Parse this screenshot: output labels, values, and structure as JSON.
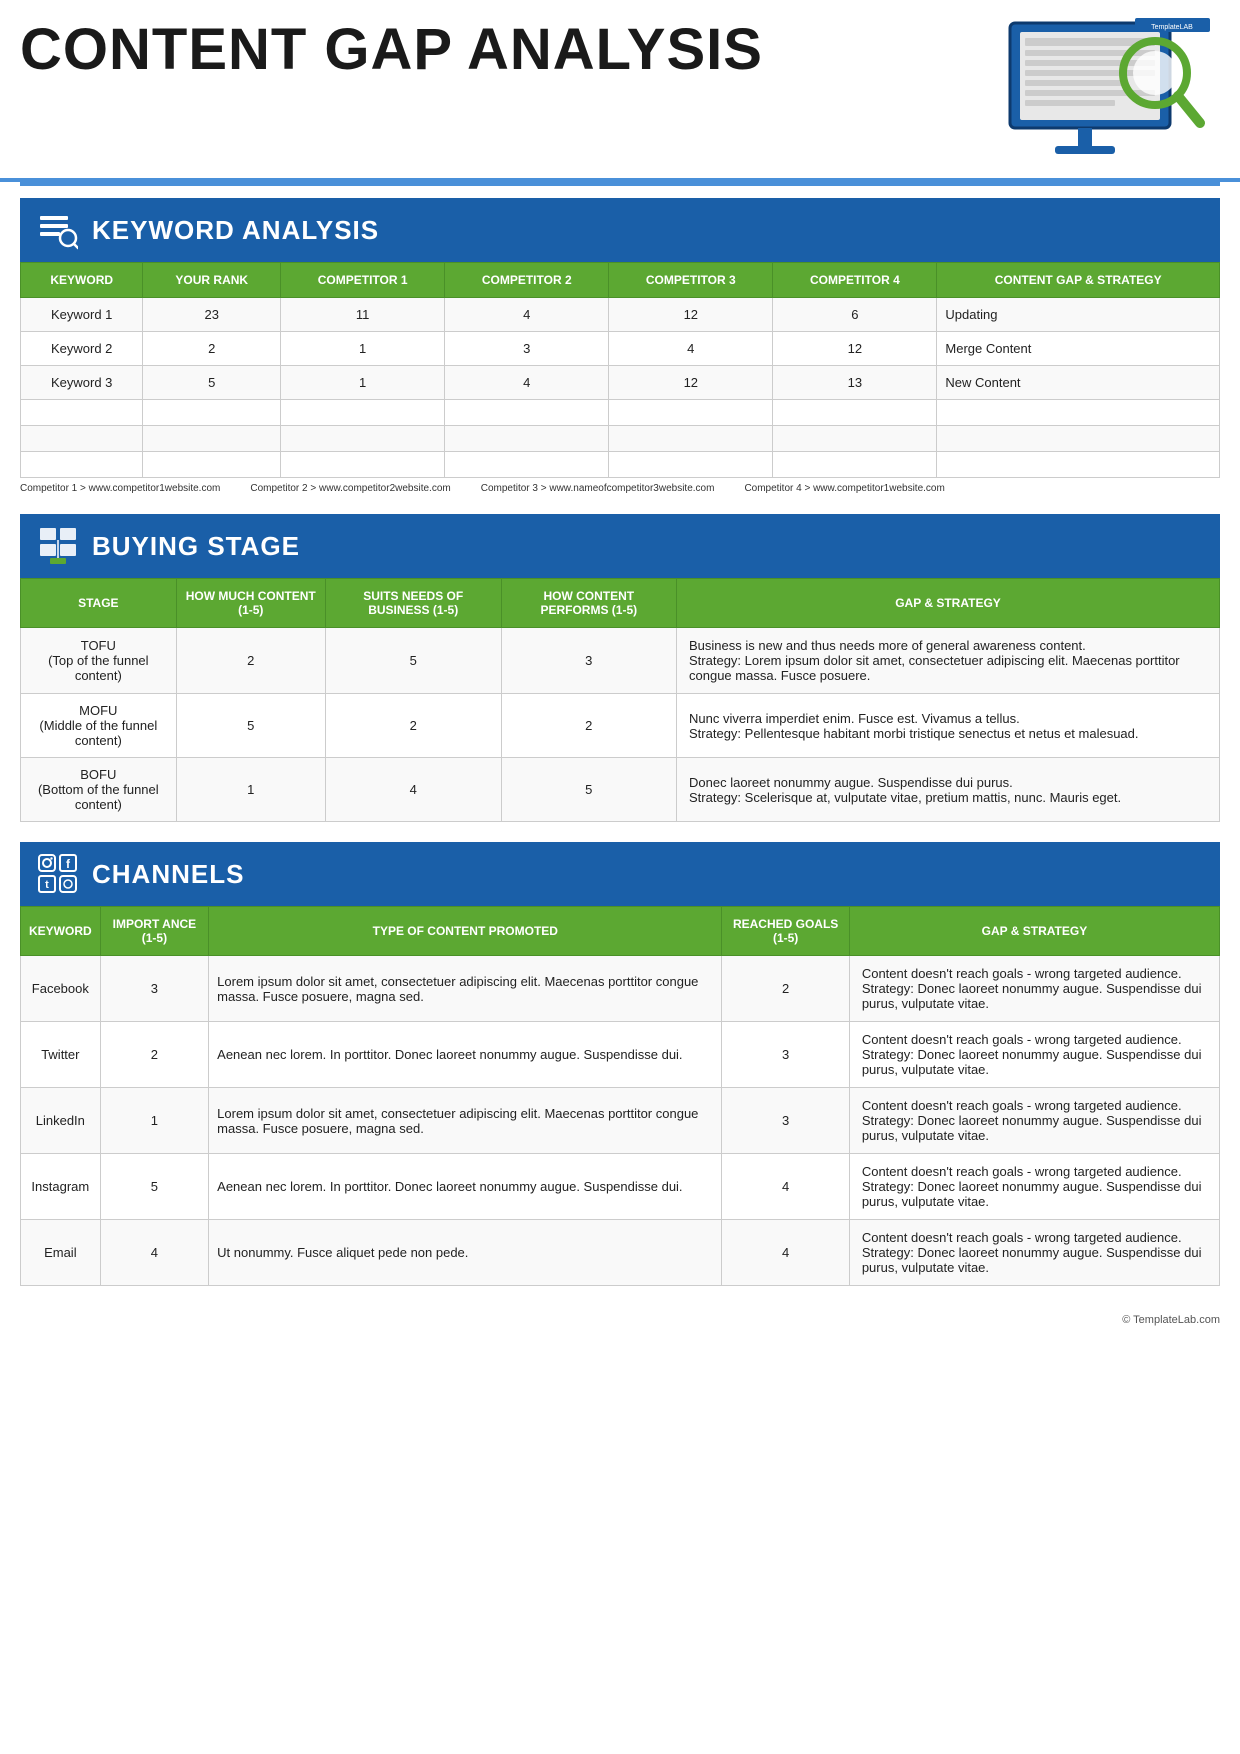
{
  "header": {
    "title": "CONTENT GAP ANALYSIS",
    "watermark": "© TemplateLab.com"
  },
  "keyword_section": {
    "section_title": "KEYWORD ANALYSIS",
    "table": {
      "headers": [
        "KEYWORD",
        "Your Rank",
        "Competitor 1",
        "Competitor 2",
        "Competitor 3",
        "Competitor 4",
        "Content Gap & Strategy"
      ],
      "rows": [
        [
          "Keyword 1",
          "23",
          "11",
          "4",
          "12",
          "6",
          "Updating"
        ],
        [
          "Keyword 2",
          "2",
          "1",
          "3",
          "4",
          "12",
          "Merge Content"
        ],
        [
          "Keyword 3",
          "5",
          "1",
          "4",
          "12",
          "13",
          "New Content"
        ],
        [
          "",
          "",
          "",
          "",
          "",
          "",
          ""
        ],
        [
          "",
          "",
          "",
          "",
          "",
          "",
          ""
        ],
        [
          "",
          "",
          "",
          "",
          "",
          "",
          ""
        ]
      ]
    },
    "competitor_notes": [
      "Competitor 1 > www.competitor1website.com",
      "Competitor 2 > www.competitor2website.com",
      "Competitor 3 > www.nameofcompetitor3website.com",
      "Competitor 4 > www.competitor1website.com"
    ]
  },
  "buying_stage_section": {
    "section_title": "BUYING STAGE",
    "table": {
      "headers": [
        "STAGE",
        "How Much Content (1-5)",
        "Suits Needs of Business (1-5)",
        "How Content Performs (1-5)",
        "Gap & Strategy"
      ],
      "rows": [
        {
          "stage": "TOFU\n(Top of the funnel content)",
          "col2": "2",
          "col3": "5",
          "col4": "3",
          "gap": "Business is new and thus needs more of general awareness content.\nStrategy: Lorem ipsum dolor sit amet, consectetuer adipiscing elit. Maecenas porttitor congue massa. Fusce posuere."
        },
        {
          "stage": "MOFU\n(Middle of the funnel content)",
          "col2": "5",
          "col3": "2",
          "col4": "2",
          "gap": "Nunc viverra imperdiet enim. Fusce est. Vivamus a tellus.\nStrategy: Pellentesque habitant morbi tristique senectus et netus et malesuad."
        },
        {
          "stage": "BOFU\n(Bottom of the funnel content)",
          "col2": "1",
          "col3": "4",
          "col4": "5",
          "gap": "Donec laoreet nonummy augue. Suspendisse dui purus.\nStrategy: Scelerisque at, vulputate vitae, pretium mattis, nunc. Mauris eget."
        }
      ]
    }
  },
  "channels_section": {
    "section_title": "CHANNELS",
    "table": {
      "headers": [
        "KEYWORD",
        "Importance (1-5)",
        "Type of content promoted",
        "Reached Goals (1-5)",
        "Gap & Strategy"
      ],
      "rows": [
        {
          "keyword": "Facebook",
          "importance": "3",
          "content_type": "Lorem ipsum dolor sit amet, consectetuer adipiscing elit. Maecenas porttitor congue massa. Fusce posuere, magna sed.",
          "reached": "2",
          "gap": "Content doesn't reach goals - wrong targeted audience.\nStrategy: Donec laoreet nonummy augue. Suspendisse dui purus, vulputate vitae."
        },
        {
          "keyword": "Twitter",
          "importance": "2",
          "content_type": "Aenean nec lorem. In porttitor. Donec laoreet nonummy augue. Suspendisse dui.",
          "reached": "3",
          "gap": "Content doesn't reach goals - wrong targeted audience.\nStrategy: Donec laoreet nonummy augue. Suspendisse dui purus, vulputate vitae."
        },
        {
          "keyword": "LinkedIn",
          "importance": "1",
          "content_type": "Lorem ipsum dolor sit amet, consectetuer adipiscing elit. Maecenas porttitor congue massa. Fusce posuere, magna sed.",
          "reached": "3",
          "gap": "Content doesn't reach goals - wrong targeted audience.\nStrategy: Donec laoreet nonummy augue. Suspendisse dui purus, vulputate vitae."
        },
        {
          "keyword": "Instagram",
          "importance": "5",
          "content_type": "Aenean nec lorem. In porttitor. Donec laoreet nonummy augue. Suspendisse dui.",
          "reached": "4",
          "gap": "Content doesn't reach goals - wrong targeted audience.\nStrategy: Donec laoreet nonummy augue. Suspendisse dui purus, vulputate vitae."
        },
        {
          "keyword": "Email",
          "importance": "4",
          "content_type": "Ut nonummy. Fusce aliquet pede non pede.",
          "reached": "4",
          "gap": "Content doesn't reach goals - wrong targeted audience.\nStrategy: Donec laoreet nonummy augue. Suspendisse dui purus, vulputate vitae."
        }
      ]
    }
  }
}
